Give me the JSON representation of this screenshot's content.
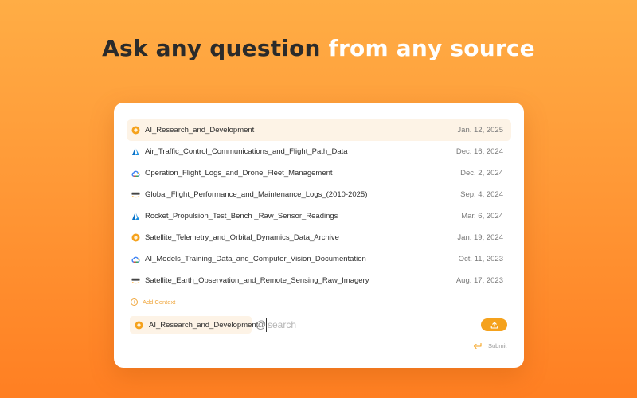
{
  "headline": {
    "part1": "Ask any question",
    "part2": "from any source"
  },
  "files": [
    {
      "name": "AI_Research_and_Development",
      "date": "Jan. 12, 2025",
      "icon": "openai-logo-icon",
      "selected": true
    },
    {
      "name": "Air_Traffic_Control_Communications_and_Flight_Path_Data",
      "date": "Dec. 16, 2024",
      "icon": "azure-logo-icon",
      "selected": false
    },
    {
      "name": "Operation_Flight_Logs_and_Drone_Fleet_Management",
      "date": "Dec. 2, 2024",
      "icon": "google-cloud-logo-icon",
      "selected": false
    },
    {
      "name": "Global_Flight_Performance_and_Maintenance_Logs_(2010-2025)",
      "date": "Sep. 4, 2024",
      "icon": "aws-logo-icon",
      "selected": false
    },
    {
      "name": "Rocket_Propulsion_Test_Bench _Raw_Sensor_Readings",
      "date": "Mar. 6, 2024",
      "icon": "azure-logo-icon",
      "selected": false
    },
    {
      "name": "Satellite_Telemetry_and_Orbital_Dynamics_Data_Archive",
      "date": "Jan. 19, 2024",
      "icon": "openai-logo-icon",
      "selected": false
    },
    {
      "name": "AI_Models_Training_Data_and_Computer_Vision_Documentation",
      "date": "Oct. 11, 2023",
      "icon": "google-cloud-logo-icon",
      "selected": false
    },
    {
      "name": "Satellite_Earth_Observation_and_Remote_Sensing_Raw_Imagery",
      "date": "Aug. 17, 2023",
      "icon": "aws-logo-icon",
      "selected": false
    }
  ],
  "add_context": {
    "label": "Add Context"
  },
  "composer": {
    "chip_label": "AI_Research_and_Development",
    "chip_icon": "openai-logo-icon",
    "at_symbol": "@",
    "search_placeholder": "search",
    "upload_icon": "upload-icon"
  },
  "submit": {
    "label": "Submit",
    "icon": "enter-icon"
  },
  "colors": {
    "accent": "#f5a21d",
    "selected_row": "#fdf3e6",
    "background_top": "#ffad45",
    "background_bottom": "#ff7f22"
  }
}
